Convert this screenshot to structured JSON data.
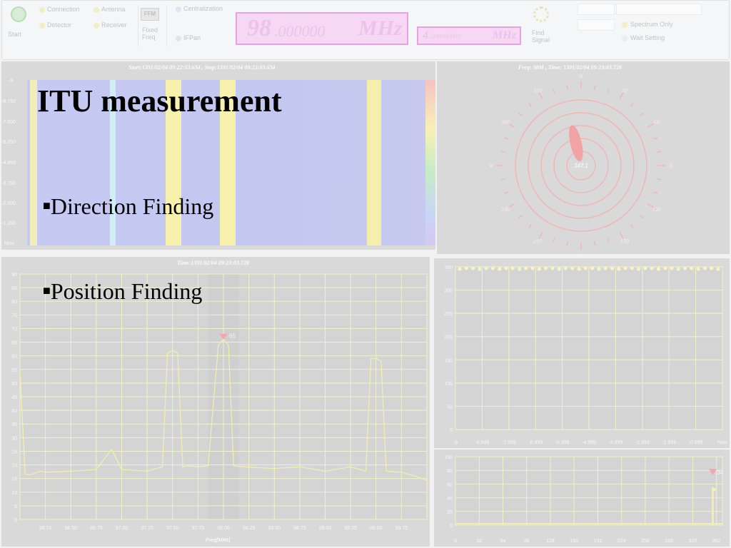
{
  "toolbar": {
    "start_label": "Start",
    "options": [
      "Connection",
      "Antenna",
      "Detector",
      "Receiver"
    ],
    "fm_badge": "FFM",
    "mode_label": "Fixed Freq",
    "dot_options": [
      "Centralization",
      "IFPan"
    ],
    "main_freq": {
      "value": "98",
      "decimals": ".000000",
      "unit": "MHz"
    },
    "span_freq": {
      "value": "4",
      "decimals": ".000000000",
      "unit": "MHz"
    },
    "right_icon_label": "Find Signal",
    "right_options": [
      "Spectrum Only",
      "Wait Setting"
    ],
    "right_dropdown": "",
    "colors": {
      "freq_bg": "#f7d8f4",
      "freq_border": "#e7a2e4"
    }
  },
  "waterfall": {
    "title": "Start:1391/02/04 09:22:53.634 , Stop:1391/02/04 09:23:03.634",
    "y_ticks": [
      "-9",
      "-8.750",
      "-7.500",
      "-6.250",
      "-4.999",
      "-3.750",
      "-2.500",
      "-1.250",
      "Now"
    ]
  },
  "compass": {
    "title": "Freq: 98M , Time: 1391/02/04 09:23:03.728",
    "labels": {
      "N": "N",
      "E": "E",
      "S": "S",
      "W": "W",
      "d30": "30",
      "d60": "60",
      "d120": "120",
      "d150": "150",
      "d210": "210",
      "d240": "240",
      "d300": "300",
      "d330": "330"
    },
    "bearing_value": "347.1",
    "bearing_deg": 347.1
  },
  "spectrum": {
    "title": "Time:1391/02/04 09:23:03.728",
    "xlabel": "Freq[MHz]",
    "marker_value": "65",
    "chart_data": {
      "type": "line",
      "x": [
        96.0,
        96.05,
        96.1,
        96.2,
        96.25,
        96.5,
        96.75,
        96.9,
        97.0,
        97.25,
        97.4,
        97.45,
        97.5,
        97.55,
        97.6,
        97.65,
        97.75,
        97.85,
        97.95,
        98.0,
        98.05,
        98.1,
        98.2,
        98.5,
        98.75,
        99.0,
        99.25,
        99.4,
        99.45,
        99.5,
        99.55,
        99.6,
        99.75,
        99.9,
        100.0
      ],
      "y": [
        55,
        17,
        16,
        18,
        17,
        18,
        18,
        26,
        18,
        18,
        19,
        61,
        62,
        61,
        19,
        20,
        19,
        20,
        64,
        66,
        64,
        20,
        19,
        19,
        19,
        18,
        19,
        18,
        59,
        59,
        58,
        18,
        17,
        16,
        14
      ],
      "xlim": [
        96.0,
        100.0
      ],
      "ylim": [
        0,
        90
      ],
      "x_ticks": [
        "96.25",
        "96.50",
        "96.75",
        "97.00",
        "97.25",
        "97.50",
        "97.75",
        "98.00",
        "98.25",
        "98.50",
        "98.75",
        "99.00",
        "99.25",
        "99.50",
        "99.75"
      ],
      "y_ticks": [
        "0",
        "5",
        "10",
        "15",
        "20",
        "25",
        "30",
        "35",
        "40",
        "45",
        "50",
        "55",
        "60",
        "65",
        "70",
        "75",
        "80",
        "85",
        "90"
      ],
      "xlabel": "Freq[MHz]",
      "grid": true
    }
  },
  "bearing_history": {
    "chart_data": {
      "type": "scatter",
      "y_value": 347,
      "ylim": [
        0,
        350
      ],
      "y_ticks": [
        "0",
        "50",
        "100",
        "150",
        "200",
        "250",
        "300",
        "350"
      ],
      "x_ticks": [
        "-9",
        "-8.999",
        "-7.999",
        "-6.999",
        "-5.999",
        "-4.999",
        "-3.999",
        "-2.999",
        "-1.999",
        "-0.999",
        "Now"
      ],
      "grid": true
    }
  },
  "bearing_histogram": {
    "marker_value": "34",
    "chart_data": {
      "type": "bar",
      "peak_x": 347,
      "peak_value": 55,
      "xlim": [
        0,
        360
      ],
      "ylim": [
        0,
        100
      ],
      "x_ticks": [
        "0",
        "32",
        "64",
        "96",
        "128",
        "160",
        "192",
        "224",
        "256",
        "288",
        "320",
        "352"
      ],
      "y_ticks": [
        "0",
        "20",
        "40",
        "60",
        "80",
        "100"
      ],
      "grid": true
    }
  },
  "slide": {
    "title": "ITU measurement",
    "bullets": [
      "Direction Finding",
      "Position Finding"
    ]
  }
}
